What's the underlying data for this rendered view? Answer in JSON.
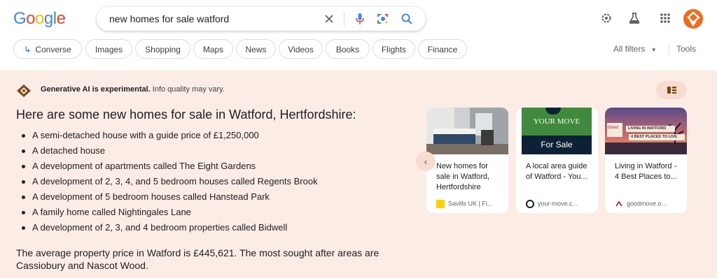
{
  "header": {
    "logo": "Google",
    "search_query": "new homes for sale watford",
    "icons": [
      "close-icon",
      "mic-icon",
      "lens-icon",
      "search-icon",
      "settings-icon",
      "labs-icon",
      "apps-icon",
      "avatar"
    ]
  },
  "chips": [
    "Converse",
    "Images",
    "Shopping",
    "Maps",
    "News",
    "Videos",
    "Books",
    "Flights",
    "Finance"
  ],
  "tools": {
    "all_filters": "All filters",
    "tools": "Tools"
  },
  "ai": {
    "note_bold": "Generative AI is experimental.",
    "note_rest": "Info quality may vary.",
    "heading": "Here are some new homes for sale in Watford, Hertfordshire:",
    "bullets": [
      "A semi-detached house with a guide price of £1,250,000",
      "A detached house",
      "A development of apartments called The Eight Gardens",
      "A development of 2, 3, 4, and 5 bedroom houses called Regents Brook",
      "A development of 5 bedroom houses called Hanstead Park",
      "A family home called Nightingales Lane",
      "A development of 2, 3, and 4 bedroom properties called Bidwell"
    ],
    "summary": "The average property price in Watford is £445,621. The most sought after areas are Cassiobury and Nascot Wood."
  },
  "cards": [
    {
      "title": "New homes for sale in Watford, Hertfordshire",
      "source": "Savills UK | Fi..."
    },
    {
      "title": "A local area guide of Watford - You...",
      "source": "your-move.c...",
      "img_text_1": "YOUR MOVE",
      "img_text_2": "For Sale"
    },
    {
      "title": "Living in Watford - 4 Best Places to...",
      "source": "goodmove.o...",
      "img_text_1": "LIVING IN WATFORD",
      "img_text_2": "4 BEST PLACES TO LIVE"
    }
  ],
  "colors": {
    "ai_bg": "#fbece5",
    "accent": "#1a73e8"
  }
}
